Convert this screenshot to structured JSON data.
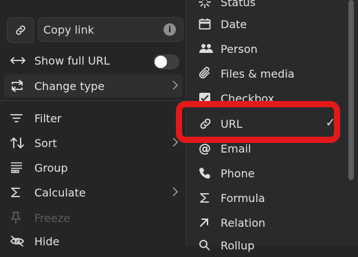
{
  "copy_link": {
    "label": "Copy link",
    "icon": "link-icon",
    "info_icon": "info-icon"
  },
  "left_menu": {
    "show_full_url": {
      "label": "Show full URL",
      "icon": "arrows-horizontal-icon",
      "toggle_on": false
    },
    "change_type": {
      "label": "Change type",
      "icon": "change-type-icon"
    },
    "filter": {
      "label": "Filter",
      "icon": "filter-icon"
    },
    "sort": {
      "label": "Sort",
      "icon": "sort-icon"
    },
    "group": {
      "label": "Group",
      "icon": "group-icon"
    },
    "calculate": {
      "label": "Calculate",
      "icon": "sigma-icon"
    },
    "freeze": {
      "label": "Freeze",
      "icon": "pin-icon"
    },
    "hide": {
      "label": "Hide",
      "icon": "eye-off-icon"
    }
  },
  "type_menu": {
    "items": [
      {
        "label": "Status",
        "icon": "status-icon"
      },
      {
        "label": "Date",
        "icon": "calendar-icon"
      },
      {
        "label": "Person",
        "icon": "people-icon"
      },
      {
        "label": "Files & media",
        "icon": "paperclip-icon"
      },
      {
        "label": "Checkbox",
        "icon": "checkbox-icon"
      },
      {
        "label": "URL",
        "icon": "link-icon",
        "selected": true
      },
      {
        "label": "Email",
        "icon": "at-icon"
      },
      {
        "label": "Phone",
        "icon": "phone-icon"
      },
      {
        "label": "Formula",
        "icon": "sigma-icon"
      },
      {
        "label": "Relation",
        "icon": "arrow-up-right-icon"
      },
      {
        "label": "Rollup",
        "icon": "search-icon"
      }
    ],
    "check_mark": "✓"
  },
  "colors": {
    "background": "#252525",
    "submenu": "#2a2a2a",
    "annotation": "#e31a1a"
  }
}
